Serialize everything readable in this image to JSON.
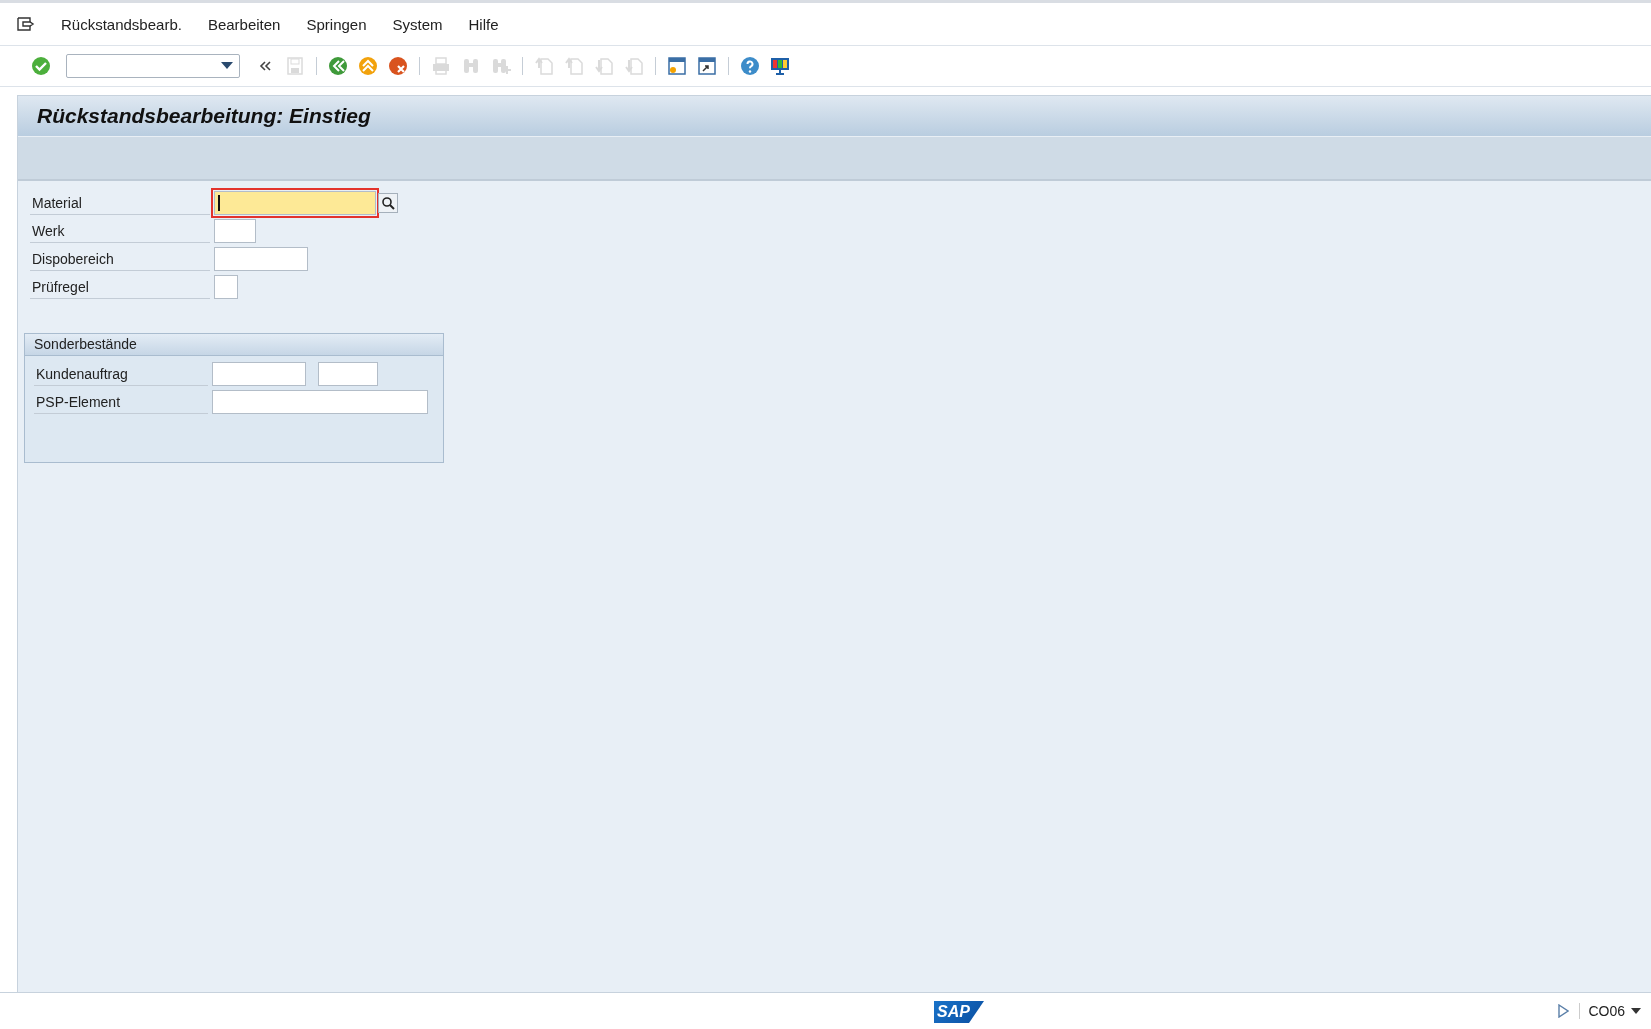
{
  "menu_bar": {
    "items": [
      {
        "label": "Rückstandsbearb."
      },
      {
        "label": "Bearbeiten"
      },
      {
        "label": "Springen"
      },
      {
        "label": "System"
      },
      {
        "label": "Hilfe"
      }
    ]
  },
  "toolbar": {
    "buttons": [
      {
        "kind": "enter",
        "disabled": false
      },
      {
        "kind": "command"
      },
      {
        "kind": "collapse"
      },
      {
        "kind": "save",
        "disabled": true
      },
      {
        "kind": "sep"
      },
      {
        "kind": "back",
        "disabled": false
      },
      {
        "kind": "exit",
        "disabled": false
      },
      {
        "kind": "cancel",
        "disabled": false
      },
      {
        "kind": "sep"
      },
      {
        "kind": "print",
        "disabled": true
      },
      {
        "kind": "find",
        "disabled": true
      },
      {
        "kind": "findnext",
        "disabled": true
      },
      {
        "kind": "sep"
      },
      {
        "kind": "first",
        "disabled": true
      },
      {
        "kind": "prev",
        "disabled": true
      },
      {
        "kind": "next",
        "disabled": true
      },
      {
        "kind": "last",
        "disabled": true
      },
      {
        "kind": "sep"
      },
      {
        "kind": "session",
        "disabled": false
      },
      {
        "kind": "shortcut",
        "disabled": false
      },
      {
        "kind": "sep"
      },
      {
        "kind": "help",
        "disabled": false
      },
      {
        "kind": "layout",
        "disabled": false
      }
    ]
  },
  "title": "Rückstandsbearbeitung: Einstieg",
  "fields": [
    {
      "label": "Material",
      "inputs": [
        {
          "focused": true,
          "search_help": true
        }
      ]
    },
    {
      "label": "Werk",
      "inputs": [
        {
          "focused": false
        }
      ]
    },
    {
      "label": "Dispobereich",
      "inputs": [
        {
          "focused": false
        }
      ]
    },
    {
      "label": "Prüfregel",
      "inputs": [
        {
          "focused": false
        }
      ]
    }
  ],
  "group": {
    "title": "Sonderbestände",
    "fields": [
      {
        "label": "Kundenauftrag",
        "inputs": [
          {
            "focused": false
          },
          {
            "focused": false
          }
        ]
      },
      {
        "label": "PSP-Element",
        "inputs": [
          {
            "focused": false
          }
        ]
      }
    ]
  },
  "status_bar": {
    "logo": "SAP",
    "transaction": "CO06"
  }
}
